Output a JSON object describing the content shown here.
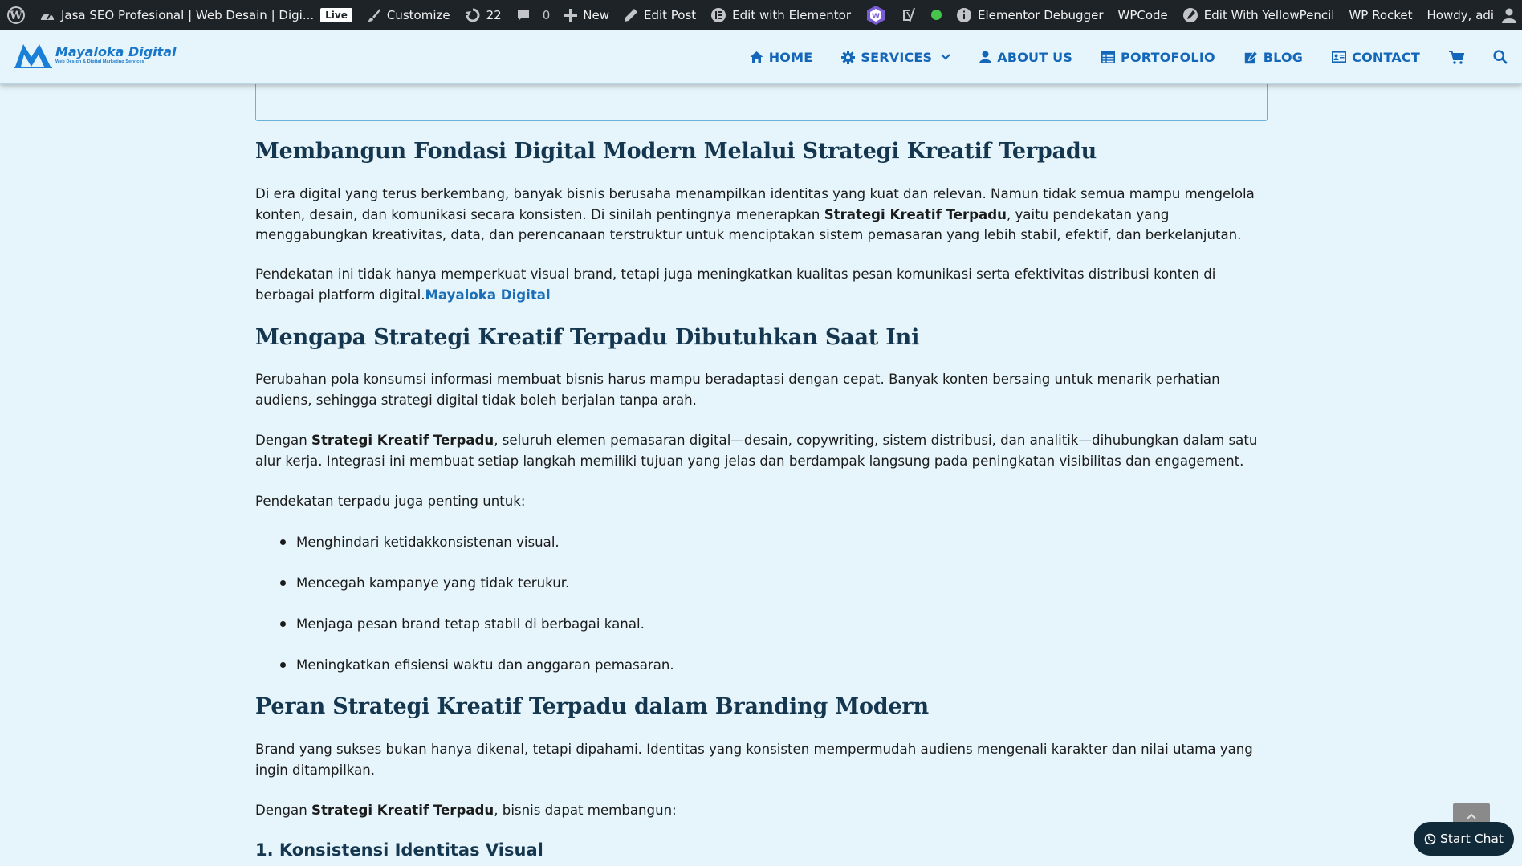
{
  "adminbar": {
    "site_title": "Jasa SEO Profesional | Web Desain | Digi...",
    "live_badge": "Live",
    "customize": "Customize",
    "updates_count": "22",
    "comments_count": "0",
    "new": "New",
    "edit_post": "Edit Post",
    "edit_elementor": "Edit with Elementor",
    "elementor_debugger": "Elementor Debugger",
    "wpcode": "WPCode",
    "yellowpencil": "Edit With YellowPencil",
    "wp_rocket": "WP Rocket",
    "howdy": "Howdy, adi"
  },
  "header": {
    "logo_name": "Mayaloka Digital",
    "logo_tagline": "Web Design & Digital Marketing Services",
    "nav": {
      "home": "HOME",
      "services": "SERVICES",
      "about": "ABOUT US",
      "portfolio": "PORTOFOLIO",
      "blog": "BLOG",
      "contact": "CONTACT"
    }
  },
  "article": {
    "h2_1": "Membangun Fondasi Digital Modern Melalui Strategi Kreatif Terpadu",
    "p1_a": "Di era digital yang terus berkembang, banyak bisnis berusaha menampilkan identitas yang kuat dan relevan. Namun tidak semua mampu mengelola konten, desain, dan komunikasi secara konsisten. Di sinilah pentingnya menerapkan ",
    "p1_bold": "Strategi Kreatif Terpadu",
    "p1_b": ", yaitu pendekatan yang menggabungkan kreativitas, data, dan perencanaan terstruktur untuk menciptakan sistem pemasaran yang lebih stabil, efektif, dan berkelanjutan.",
    "p2_a": "Pendekatan ini tidak hanya memperkuat visual brand, tetapi juga meningkatkan kualitas pesan komunikasi serta efektivitas distribusi konten di berbagai platform digital.",
    "p2_link": "Mayaloka Digital",
    "h2_2": "Mengapa Strategi Kreatif Terpadu Dibutuhkan Saat Ini",
    "p3": "Perubahan pola konsumsi informasi membuat bisnis harus mampu beradaptasi dengan cepat. Banyak konten bersaing untuk menarik perhatian audiens, sehingga strategi digital tidak boleh berjalan tanpa arah.",
    "p4_a": "Dengan ",
    "p4_bold": "Strategi Kreatif Terpadu",
    "p4_b": ", seluruh elemen pemasaran digital—desain, copywriting, sistem distribusi, dan analitik—dihubungkan dalam satu alur kerja. Integrasi ini membuat setiap langkah memiliki tujuan yang jelas dan berdampak langsung pada peningkatan visibilitas dan engagement.",
    "p5": "Pendekatan terpadu juga penting untuk:",
    "list": [
      "Menghindari ketidakkonsistenan visual.",
      "Mencegah kampanye yang tidak terukur.",
      "Menjaga pesan brand tetap stabil di berbagai kanal.",
      "Meningkatkan efisiensi waktu dan anggaran pemasaran."
    ],
    "h2_3": "Peran Strategi Kreatif Terpadu dalam Branding Modern",
    "p6": "Brand yang sukses bukan hanya dikenal, tetapi dipahami. Identitas yang konsisten mempermudah audiens mengenali karakter dan nilai utama yang ingin ditampilkan.",
    "p7_a": "Dengan ",
    "p7_bold": "Strategi Kreatif Terpadu",
    "p7_b": ", bisnis dapat membangun:",
    "h3_1": "1. Konsistensi Identitas Visual"
  },
  "chat": {
    "label": "Start Chat"
  },
  "colors": {
    "accent": "#1366b8",
    "background": "#e6f5fb",
    "admin_bar": "#1d2327",
    "heading": "#15364f"
  }
}
